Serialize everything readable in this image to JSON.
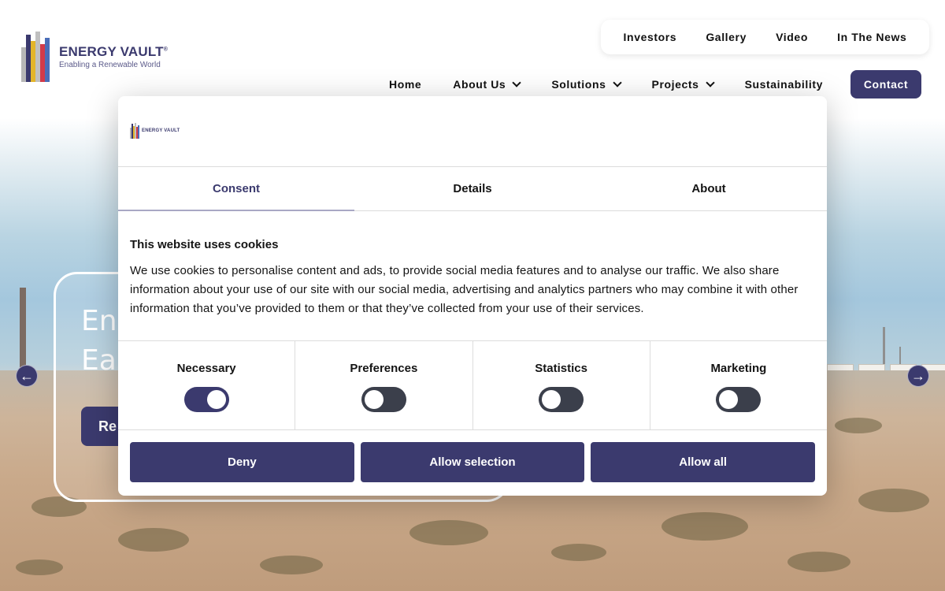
{
  "header": {
    "logo": {
      "name": "ENERGY VAULT",
      "trademark": "®",
      "tagline": "Enabling a Renewable World"
    },
    "top_links": [
      "Investors",
      "Gallery",
      "Video",
      "In The News"
    ],
    "nav": {
      "home": "Home",
      "about": "About Us",
      "solutions": "Solutions",
      "projects": "Projects",
      "sustainability": "Sustainability",
      "contact": "Contact"
    }
  },
  "hero": {
    "line1": "Ene",
    "line2": "Ear",
    "button": "Re",
    "prev_arrow": "←",
    "next_arrow": "→"
  },
  "cookie_dialog": {
    "logo_text": "ENERGY VAULT",
    "tabs": [
      "Consent",
      "Details",
      "About"
    ],
    "active_tab": "Consent",
    "title": "This website uses cookies",
    "body": "We use cookies to personalise content and ads, to provide social media features and to analyse our traffic. We also share information about your use of our site with our social media, advertising and analytics partners who may combine it with other information that you’ve provided to them or that they’ve collected from your use of their services.",
    "categories": [
      {
        "label": "Necessary",
        "checked": true
      },
      {
        "label": "Preferences",
        "checked": false
      },
      {
        "label": "Statistics",
        "checked": false
      },
      {
        "label": "Marketing",
        "checked": false
      }
    ],
    "buttons": {
      "deny": "Deny",
      "allow_selection": "Allow selection",
      "allow_all": "Allow all"
    }
  },
  "colors": {
    "brand": "#3b3a6e",
    "toggle_off": "#3b3f4b",
    "tab_underline": "#a9a8c4"
  }
}
